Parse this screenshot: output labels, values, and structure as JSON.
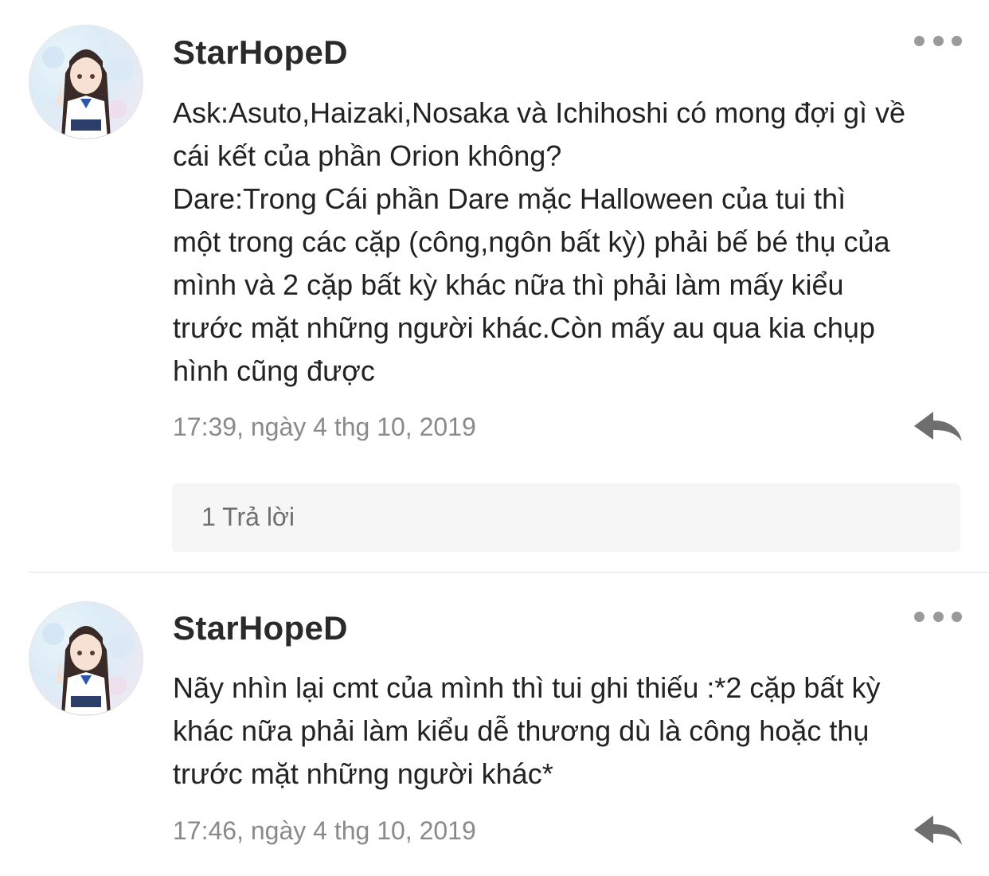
{
  "comments": [
    {
      "username": "StarHopeD",
      "lines": [
        "Ask:Asuto,Haizaki,Nosaka và Ichihoshi có mong đợi gì về",
        "cái kết của phần Orion không?",
        "Dare:Trong Cái phần Dare mặc Halloween của tui thì",
        "một trong các cặp (công,ngôn bất kỳ) phải bế bé thụ của",
        "mình và 2 cặp bất kỳ khác nữa thì phải làm mấy kiểu",
        "trước mặt những người khác.Còn mấy au qua kia chụp",
        "hình cũng được"
      ],
      "timestamp": "17:39, ngày 4 thg 10, 2019",
      "replies_label": "1 Trả lời",
      "more_icon": "more-horizontal-icon",
      "reply_icon": "reply-arrow-icon"
    },
    {
      "username": "StarHopeD",
      "lines": [
        "Nãy nhìn lại cmt của mình thì tui ghi thiếu :*2 cặp bất kỳ",
        "khác nữa phải làm kiểu dễ thương dù là công hoặc thụ",
        "trước mặt những người khác*"
      ],
      "timestamp": "17:46, ngày 4 thg 10, 2019",
      "more_icon": "more-horizontal-icon",
      "reply_icon": "reply-arrow-icon"
    }
  ],
  "colors": {
    "text": "#222222",
    "muted": "#8a8a8a",
    "icon": "#6e6e6e",
    "reply_box_bg": "#f6f6f6",
    "divider": "#e4e4e4"
  }
}
